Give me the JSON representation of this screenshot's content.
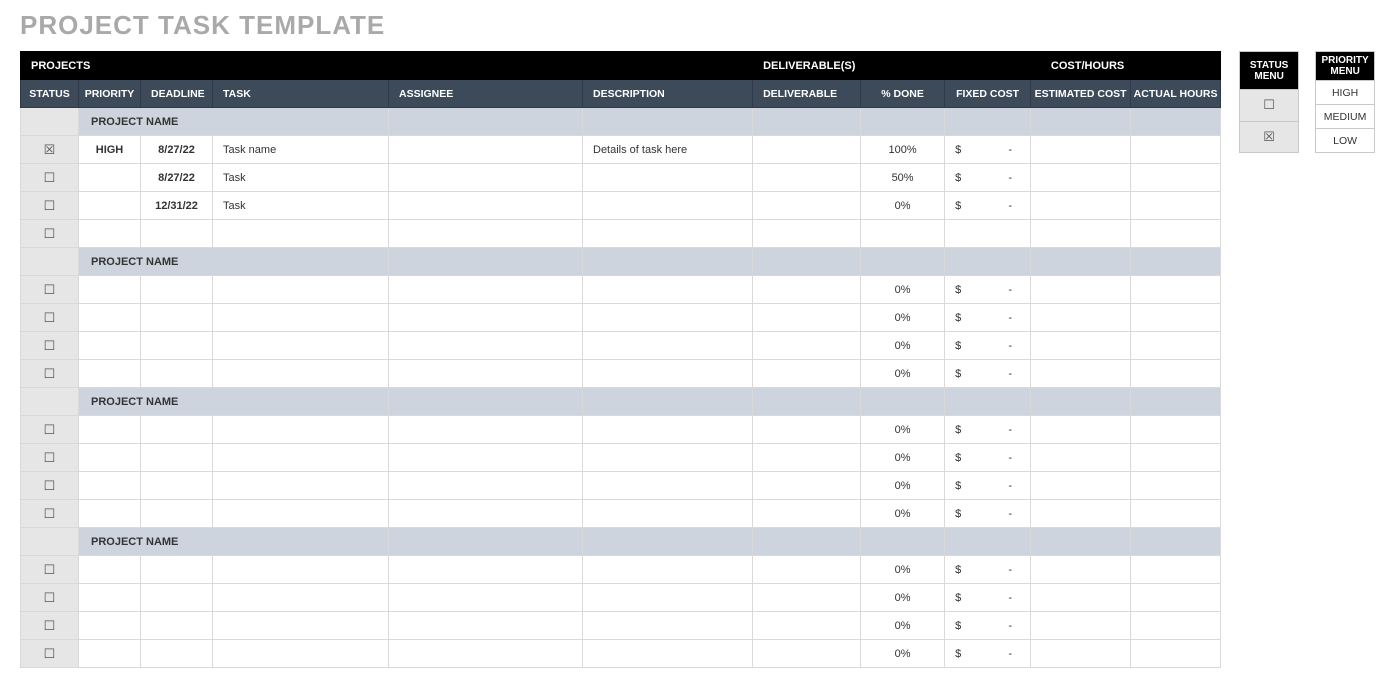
{
  "title": "PROJECT TASK TEMPLATE",
  "groupHeaders": {
    "projects": "PROJECTS",
    "deliverables": "DELIVERABLE(S)",
    "costHours": "COST/HOURS"
  },
  "columns": {
    "status": "STATUS",
    "priority": "PRIORITY",
    "deadline": "DEADLINE",
    "task": "TASK",
    "assignee": "ASSIGNEE",
    "description": "DESCRIPTION",
    "deliverable": "DELIVERABLE",
    "pctDone": "% DONE",
    "fixedCost": "FIXED COST",
    "estCost": "ESTIMATED COST",
    "actualHours": "ACTUAL HOURS"
  },
  "costSymbol": "$",
  "costDash": "-",
  "sections": [
    {
      "name": "PROJECT NAME",
      "rows": [
        {
          "checked": true,
          "priority": "HIGH",
          "deadline": "8/27/22",
          "task": "Task name",
          "assignee": "",
          "description": "Details of task here",
          "deliverable": "",
          "pctDone": "100%",
          "fixedCost": true,
          "estCost": "",
          "actualHours": ""
        },
        {
          "checked": false,
          "priority": "",
          "deadline": "8/27/22",
          "task": "Task",
          "assignee": "",
          "description": "",
          "deliverable": "",
          "pctDone": "50%",
          "fixedCost": true,
          "estCost": "",
          "actualHours": ""
        },
        {
          "checked": false,
          "priority": "",
          "deadline": "12/31/22",
          "task": "Task",
          "assignee": "",
          "description": "",
          "deliverable": "",
          "pctDone": "0%",
          "fixedCost": true,
          "estCost": "",
          "actualHours": ""
        },
        {
          "checked": false,
          "priority": "",
          "deadline": "",
          "task": "",
          "assignee": "",
          "description": "",
          "deliverable": "",
          "pctDone": "",
          "fixedCost": false,
          "estCost": "",
          "actualHours": ""
        }
      ]
    },
    {
      "name": "PROJECT NAME",
      "rows": [
        {
          "checked": false,
          "priority": "",
          "deadline": "",
          "task": "",
          "assignee": "",
          "description": "",
          "deliverable": "",
          "pctDone": "0%",
          "fixedCost": true,
          "estCost": "",
          "actualHours": ""
        },
        {
          "checked": false,
          "priority": "",
          "deadline": "",
          "task": "",
          "assignee": "",
          "description": "",
          "deliverable": "",
          "pctDone": "0%",
          "fixedCost": true,
          "estCost": "",
          "actualHours": ""
        },
        {
          "checked": false,
          "priority": "",
          "deadline": "",
          "task": "",
          "assignee": "",
          "description": "",
          "deliverable": "",
          "pctDone": "0%",
          "fixedCost": true,
          "estCost": "",
          "actualHours": ""
        },
        {
          "checked": false,
          "priority": "",
          "deadline": "",
          "task": "",
          "assignee": "",
          "description": "",
          "deliverable": "",
          "pctDone": "0%",
          "fixedCost": true,
          "estCost": "",
          "actualHours": ""
        }
      ]
    },
    {
      "name": "PROJECT NAME",
      "rows": [
        {
          "checked": false,
          "priority": "",
          "deadline": "",
          "task": "",
          "assignee": "",
          "description": "",
          "deliverable": "",
          "pctDone": "0%",
          "fixedCost": true,
          "estCost": "",
          "actualHours": ""
        },
        {
          "checked": false,
          "priority": "",
          "deadline": "",
          "task": "",
          "assignee": "",
          "description": "",
          "deliverable": "",
          "pctDone": "0%",
          "fixedCost": true,
          "estCost": "",
          "actualHours": ""
        },
        {
          "checked": false,
          "priority": "",
          "deadline": "",
          "task": "",
          "assignee": "",
          "description": "",
          "deliverable": "",
          "pctDone": "0%",
          "fixedCost": true,
          "estCost": "",
          "actualHours": ""
        },
        {
          "checked": false,
          "priority": "",
          "deadline": "",
          "task": "",
          "assignee": "",
          "description": "",
          "deliverable": "",
          "pctDone": "0%",
          "fixedCost": true,
          "estCost": "",
          "actualHours": ""
        }
      ]
    },
    {
      "name": "PROJECT NAME",
      "rows": [
        {
          "checked": false,
          "priority": "",
          "deadline": "",
          "task": "",
          "assignee": "",
          "description": "",
          "deliverable": "",
          "pctDone": "0%",
          "fixedCost": true,
          "estCost": "",
          "actualHours": ""
        },
        {
          "checked": false,
          "priority": "",
          "deadline": "",
          "task": "",
          "assignee": "",
          "description": "",
          "deliverable": "",
          "pctDone": "0%",
          "fixedCost": true,
          "estCost": "",
          "actualHours": ""
        },
        {
          "checked": false,
          "priority": "",
          "deadline": "",
          "task": "",
          "assignee": "",
          "description": "",
          "deliverable": "",
          "pctDone": "0%",
          "fixedCost": true,
          "estCost": "",
          "actualHours": ""
        },
        {
          "checked": false,
          "priority": "",
          "deadline": "",
          "task": "",
          "assignee": "",
          "description": "",
          "deliverable": "",
          "pctDone": "0%",
          "fixedCost": true,
          "estCost": "",
          "actualHours": ""
        }
      ]
    }
  ],
  "statusMenu": {
    "header": "STATUS MENU",
    "items": [
      {
        "checked": false
      },
      {
        "checked": true
      }
    ]
  },
  "priorityMenu": {
    "header": "PRIORITY MENU",
    "items": [
      "HIGH",
      "MEDIUM",
      "LOW"
    ]
  }
}
